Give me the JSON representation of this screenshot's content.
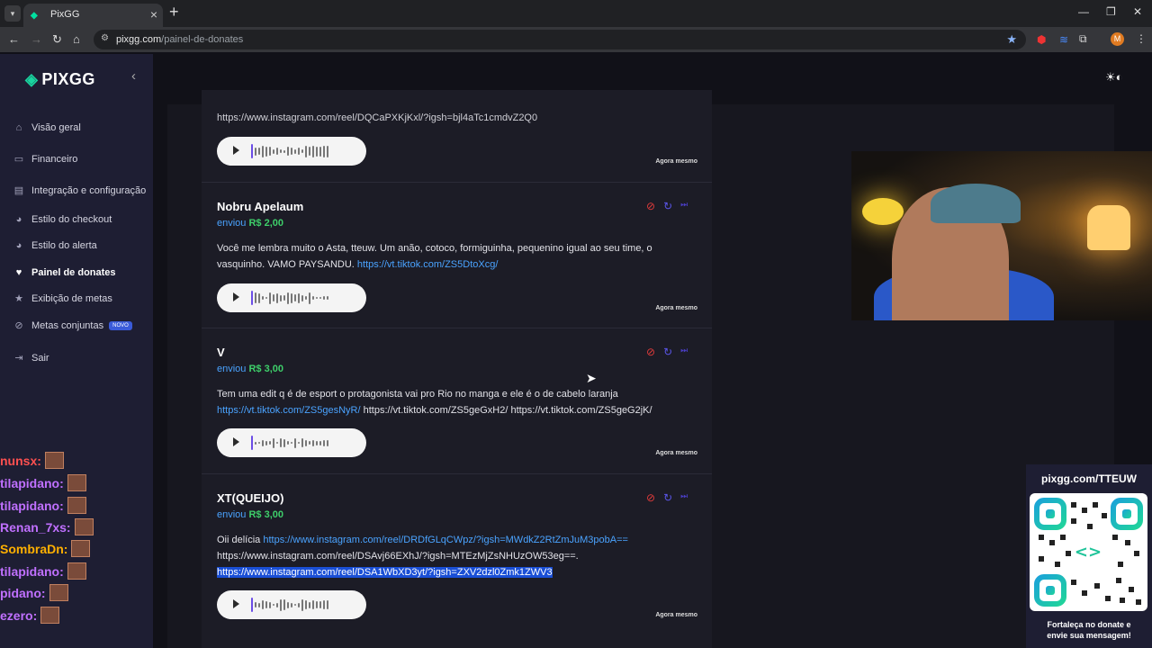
{
  "browser": {
    "tab_title": "PixGG",
    "url_host": "pixgg.com",
    "url_path": "/painel-de-donates",
    "avatar_letter": "M"
  },
  "sidebar": {
    "logo": "PIXGG",
    "items": [
      {
        "label": "Visão geral",
        "icon": "home-icon"
      },
      {
        "label": "Financeiro",
        "icon": "wallet-icon"
      },
      {
        "label": "Integração e configuração",
        "icon": "settings-icon"
      },
      {
        "label": "Estilo do checkout",
        "icon": "palette-icon"
      },
      {
        "label": "Estilo do alerta",
        "icon": "palette-icon"
      },
      {
        "label": "Painel de donates",
        "icon": "donate-icon"
      },
      {
        "label": "Exibição de metas",
        "icon": "star-icon"
      },
      {
        "label": "Metas conjuntas",
        "icon": "target-icon",
        "badge": "NOVO"
      },
      {
        "label": "Sair",
        "icon": "logout-icon"
      }
    ],
    "active_index": 5
  },
  "donates": [
    {
      "name": "",
      "verb": "",
      "amount": "",
      "message_parts": [
        {
          "text": "https://www.instagram.com/reel/DQCaPXKjKxl/?igsh=bjl4aTc1cmdvZ2Q0",
          "type": "text"
        }
      ],
      "time": "Agora mesmo"
    },
    {
      "name": "Nobru Apelaum",
      "verb": "enviou",
      "amount": "R$ 2,00",
      "message_parts": [
        {
          "text": "Você me lembra muito o Asta, tteuw. Um anão, cotoco, formiguinha, pequenino igual ao seu time, o vasquinho. VAMO PAYSANDU. ",
          "type": "text"
        },
        {
          "text": "https://vt.tiktok.com/ZS5DtoXcg/",
          "type": "link"
        }
      ],
      "time": "Agora mesmo"
    },
    {
      "name": "V",
      "verb": "enviou",
      "amount": "R$ 3,00",
      "message_parts": [
        {
          "text": "Tem uma edit q é de esport o protagonista vai pro Rio no manga e ele é o de cabelo laranja ",
          "type": "text"
        },
        {
          "text": "https://vt.tiktok.com/ZS5gesNyR/",
          "type": "link"
        },
        {
          "text": " https://vt.tiktok.com/ZS5geGxH2/ https://vt.tiktok.com/ZS5geG2jK/",
          "type": "text"
        }
      ],
      "time": "Agora mesmo"
    },
    {
      "name": "XT(QUEIJO)",
      "verb": "enviou",
      "amount": "R$ 3,00",
      "message_parts": [
        {
          "text": "Oii delícia ",
          "type": "text"
        },
        {
          "text": "https://www.instagram.com/reel/DRDfGLqCWpz/?igsh=MWdkZ2RtZmJuM3pobA==",
          "type": "link"
        },
        {
          "text": " https://www.instagram.com/reel/DSAvj66EXhJ/?igsh=MTEzMjZsNHUzOW53eg==. ",
          "type": "text"
        },
        {
          "text": "https://www.instagram.com/reel/DSA1WbXD3yt/?igsh=ZXV2dzl0Zmk1ZWV3",
          "type": "highlight"
        }
      ],
      "time": "Agora mesmo"
    }
  ],
  "chat": [
    {
      "user": "nunsx:",
      "color": "#ff5050"
    },
    {
      "user": "tilapidano:",
      "color": "#c070ff"
    },
    {
      "user": "tilapidano:",
      "color": "#c070ff"
    },
    {
      "user": "Renan_7xs:",
      "color": "#c070ff"
    },
    {
      "user": "SombraDn:",
      "color": "#ffb000"
    },
    {
      "user": "tilapidano:",
      "color": "#c070ff"
    },
    {
      "user": "pidano:",
      "color": "#c070ff"
    },
    {
      "user": "ezero:",
      "color": "#c070ff"
    }
  ],
  "qr_panel": {
    "url": "pixgg.com/TTEUW",
    "caption_line1": "Fortaleça no donate e",
    "caption_line2": "envie sua mensagem!"
  },
  "colors": {
    "link": "#4aa3ff",
    "amount": "#3ecf6a",
    "sidebar_bg": "#1e1e33",
    "accent": "#19d5a0"
  }
}
